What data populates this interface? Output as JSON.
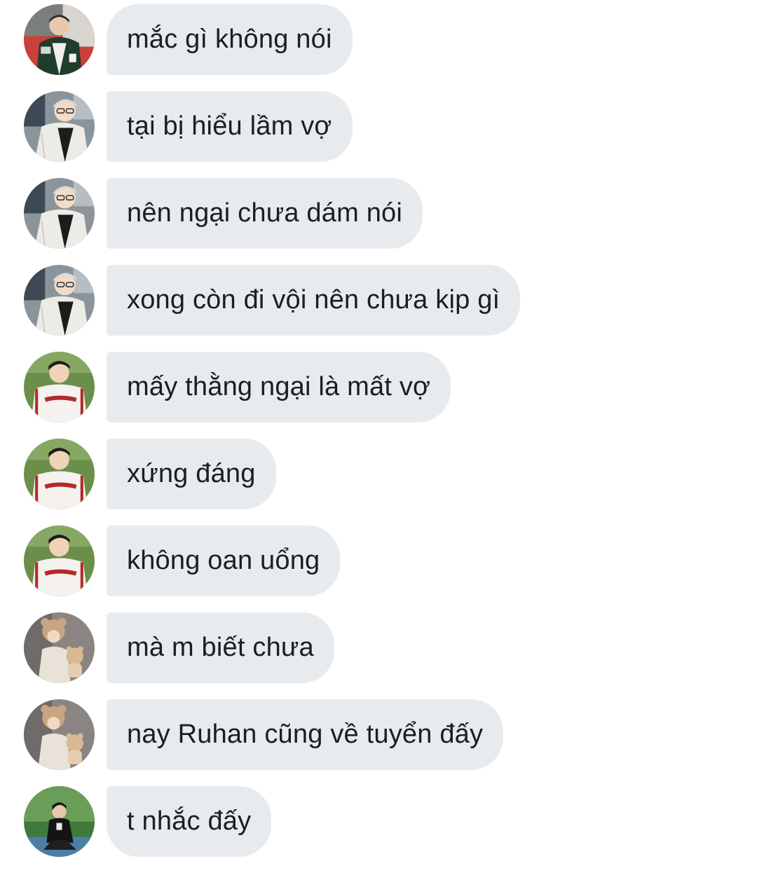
{
  "messages": [
    {
      "text": "mắc gì không nói",
      "avatar": "avatar-person-jacket-icon"
    },
    {
      "text": "tại bị hiểu lầm vợ",
      "avatar": "avatar-person-glasses-icon"
    },
    {
      "text": "nên ngại chưa dám nói",
      "avatar": "avatar-person-glasses-icon"
    },
    {
      "text": "xong còn đi vội nên chưa kịp gì",
      "avatar": "avatar-person-glasses-icon"
    },
    {
      "text": "mấy thằng ngại là mất vợ",
      "avatar": "avatar-person-baseball-jersey-icon"
    },
    {
      "text": "xứng đáng",
      "avatar": "avatar-person-baseball-jersey-icon"
    },
    {
      "text": "không oan uổng",
      "avatar": "avatar-person-baseball-jersey-icon"
    },
    {
      "text": "mà m biết chưa",
      "avatar": "avatar-person-bear-hat-icon"
    },
    {
      "text": "nay Ruhan cũng về tuyển đấy",
      "avatar": "avatar-person-bear-hat-icon"
    },
    {
      "text": "t nhắc đấy",
      "avatar": "avatar-person-crouching-icon"
    }
  ],
  "colors": {
    "bubble_bg": "#e8ebee",
    "text": "#1c1e21",
    "page_bg": "#ffffff"
  }
}
